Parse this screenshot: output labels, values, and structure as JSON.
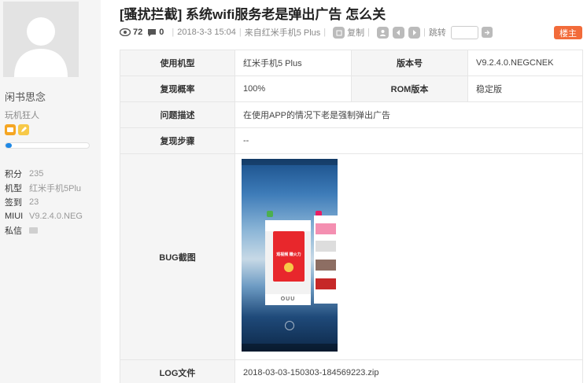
{
  "post": {
    "title": "[骚扰拦截] 系统wifi服务老是弹出广告 怎么关",
    "views": "72",
    "replies": "0",
    "date": "2018-3-3 15:04",
    "device_from": "来自红米手机5 Plus",
    "copy_label": "复制",
    "jump_label": "跳转",
    "floor_label": "楼主"
  },
  "user": {
    "name": "闲书思念",
    "group": "玩机狂人",
    "level_progress": 0.08,
    "stats": [
      {
        "key": "积分",
        "value": "235"
      },
      {
        "key": "机型",
        "value": "红米手机5Plu"
      },
      {
        "key": "签到",
        "value": "23"
      },
      {
        "key": "MIUI",
        "value": "V9.2.4.0.NEG"
      },
      {
        "key": "私信",
        "value": ""
      }
    ]
  },
  "report": {
    "device_label": "使用机型",
    "device_value": "红米手机5 Plus",
    "version_label": "版本号",
    "version_value": "V9.2.4.0.NEGCNEK",
    "rate_label": "复现概率",
    "rate_value": "100%",
    "rom_label": "ROM版本",
    "rom_value": "稳定版",
    "desc_label": "问题描述",
    "desc_value": "在使用APP的情况下老是强制弹出广告",
    "steps_label": "复现步骤",
    "steps_value": "--",
    "bug_label": "BUG截图",
    "log_label": "LOG文件",
    "log_value": "2018-03-03-150303-184569223.zip"
  },
  "screenshot": {
    "promo_text": "观视频 赚火力",
    "logo_text": "OUU"
  },
  "colors": {
    "accent": "#f26b3a",
    "progress": "#1e88e5"
  }
}
